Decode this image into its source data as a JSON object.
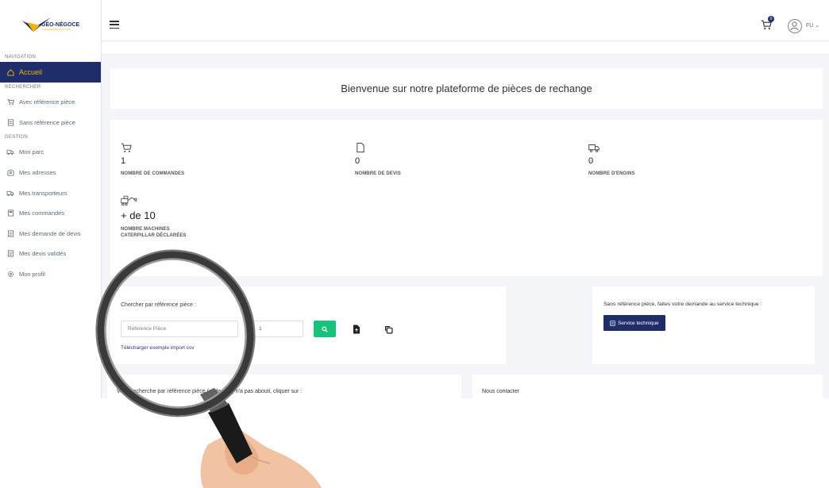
{
  "brand": {
    "name": "GÉO-NÉGOCE",
    "tagline": "LE PARTENAIRE DE SUCCÈS",
    "colors": {
      "navy": "#1f2d6b",
      "gold": "#f5b400",
      "green": "#19c27a"
    }
  },
  "sidebar": {
    "sections": [
      {
        "title": "NAVIGATION",
        "items": [
          {
            "label": "Accueil",
            "icon": "home-icon",
            "active": true
          }
        ]
      },
      {
        "title": "RECHERCHER",
        "items": [
          {
            "label": "Avec référence pièce",
            "icon": "cart-icon"
          },
          {
            "label": "Sans référence pièce",
            "icon": "document-icon"
          }
        ]
      },
      {
        "title": "GESTION",
        "items": [
          {
            "label": "Mon parc",
            "icon": "truck-icon"
          },
          {
            "label": "Mes adresses",
            "icon": "address-icon"
          },
          {
            "label": "Mes transporteurs",
            "icon": "truck-icon"
          },
          {
            "label": "Mes commandes",
            "icon": "order-icon"
          },
          {
            "label": "Mes demande de devis",
            "icon": "quote-icon"
          },
          {
            "label": "Mes devis validés",
            "icon": "quote-icon"
          },
          {
            "label": "Mon profil",
            "icon": "gear-icon"
          }
        ]
      }
    ]
  },
  "topbar": {
    "cart_count": "0",
    "user_initials": "FU ⌄"
  },
  "welcome": {
    "title": "Bienvenue sur notre plateforme de pièces de rechange"
  },
  "stats": [
    {
      "icon": "cart-icon",
      "value": "1",
      "label": "NOMBRE DE COMMANDES"
    },
    {
      "icon": "document-icon",
      "value": "0",
      "label": "NOMBRE DE DEVIS"
    },
    {
      "icon": "truck-icon",
      "value": "0",
      "label": "NOMBRE D'ENGINS"
    },
    {
      "icon": "machine-icon",
      "value": "+ de 10",
      "label_line1": "NOMBRE MACHINES",
      "label_line2": "CATERPILLAR DÉCLARÉES"
    }
  ],
  "search": {
    "label": "Chercher par référence pièce :",
    "ref_placeholder": "Référence Pièce",
    "qty_value": "1",
    "csv_link": "Télécharger exemple import csv"
  },
  "service": {
    "text": "Sans référence pièce, faites votre demande au service technique :",
    "button": "Service technique"
  },
  "bottom": {
    "left_text": "Votre recherche par référence pièce (ci-dessus) n'a pas abouti, cliquer sur :",
    "right_text": "Nous contacter"
  }
}
